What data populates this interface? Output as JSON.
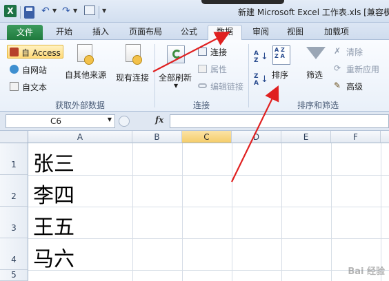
{
  "window": {
    "title": "新建 Microsoft Excel 工作表.xls  [兼容模"
  },
  "tabs": [
    {
      "label": "文件"
    },
    {
      "label": "开始"
    },
    {
      "label": "插入"
    },
    {
      "label": "页面布局"
    },
    {
      "label": "公式"
    },
    {
      "label": "数据"
    },
    {
      "label": "审阅"
    },
    {
      "label": "视图"
    },
    {
      "label": "加载项"
    }
  ],
  "ribbon": {
    "get_external": {
      "access": "自 Access",
      "web": "自网站",
      "text": "自文本",
      "other": "自其他来源",
      "existing": "现有连接",
      "label": "获取外部数据"
    },
    "connections": {
      "refresh_all": "全部刷新",
      "connections": "连接",
      "properties": "属性",
      "edit_links": "编辑链接",
      "label": "连接"
    },
    "sort_filter": {
      "sort": "排序",
      "filter": "筛选",
      "clear": "清除",
      "reapply": "重新应用",
      "advanced": "高级",
      "label": "排序和筛选"
    }
  },
  "formula_bar": {
    "name_box": "C6",
    "fx": "fx",
    "formula": ""
  },
  "grid": {
    "columns": [
      "A",
      "B",
      "C",
      "D",
      "E",
      "F"
    ],
    "selected_column": "C",
    "rows": [
      {
        "num": "1",
        "a": "张三"
      },
      {
        "num": "2",
        "a": "李四"
      },
      {
        "num": "3",
        "a": "王五"
      },
      {
        "num": "4",
        "a": "马六"
      },
      {
        "num": "5",
        "a": ""
      }
    ]
  },
  "watermark": "Bai 经验"
}
